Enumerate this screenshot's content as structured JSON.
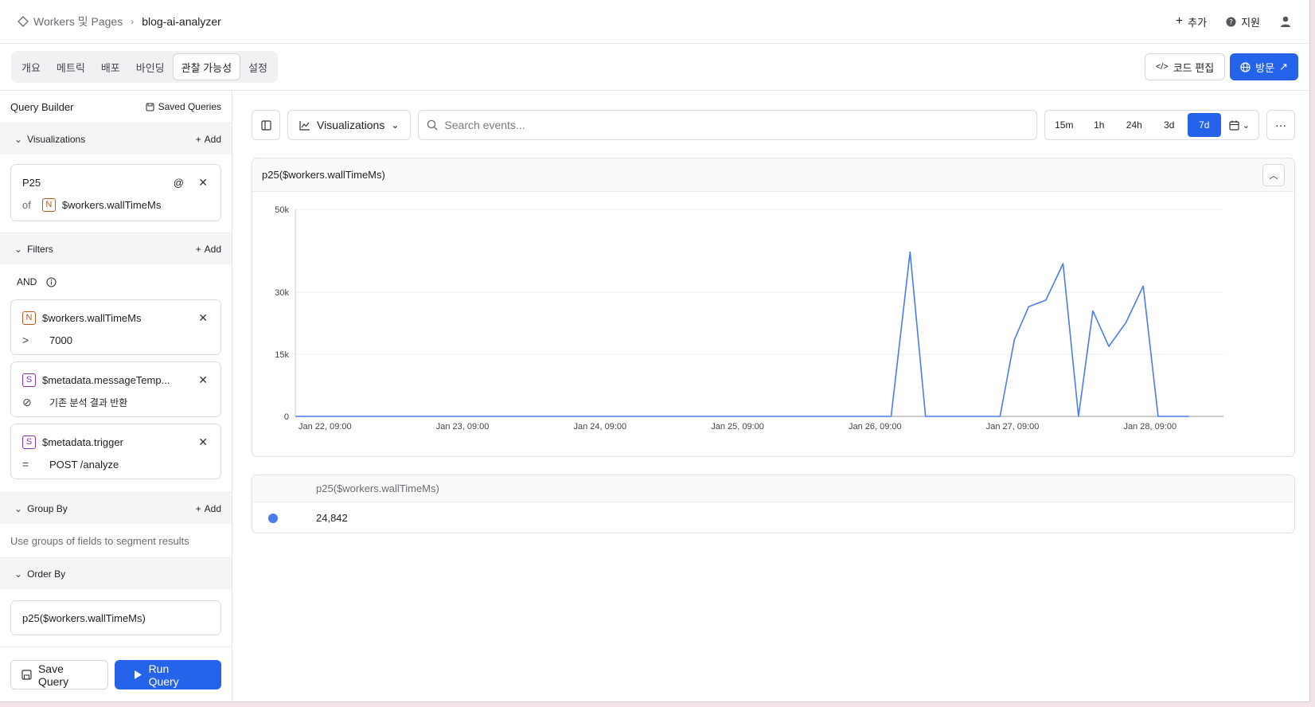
{
  "header": {
    "breadcrumb_parent": "Workers 및 Pages",
    "breadcrumb_current": "blog-ai-analyzer",
    "add_label": "추가",
    "support_label": "지원"
  },
  "tabs": [
    "개요",
    "메트릭",
    "배포",
    "바인딩",
    "관찰 가능성",
    "설정"
  ],
  "active_tab": "관찰 가능성",
  "actions": {
    "edit_code": "코드 편집",
    "visit": "방문"
  },
  "sidebar": {
    "title": "Query Builder",
    "saved_queries": "Saved Queries",
    "visualizations": {
      "label": "Visualizations",
      "add": "Add",
      "item": {
        "func": "P25",
        "of": "of",
        "type_badge": "N",
        "field": "$workers.wallTimeMs"
      }
    },
    "filters": {
      "label": "Filters",
      "add": "Add",
      "logic": "AND",
      "items": [
        {
          "badge": "N",
          "field": "$workers.wallTimeMs",
          "operator": ">",
          "value": "7000"
        },
        {
          "badge": "S",
          "field": "$metadata.messageTemp...",
          "operator": "⊘",
          "value": "기존 분석 결과 반환"
        },
        {
          "badge": "S",
          "field": "$metadata.trigger",
          "operator": "=",
          "value": "POST /analyze"
        }
      ]
    },
    "group_by": {
      "label": "Group By",
      "add": "Add",
      "hint": "Use groups of fields to segment results"
    },
    "order_by": {
      "label": "Order By",
      "item": "p25($workers.wallTimeMs)"
    },
    "save_query": "Save Query",
    "run_query": "Run Query"
  },
  "toolbar": {
    "visualizations_label": "Visualizations",
    "search_placeholder": "Search events...",
    "ranges": [
      "15m",
      "1h",
      "24h",
      "3d",
      "7d"
    ],
    "active_range": "7d"
  },
  "chart_data": {
    "type": "line",
    "title": "p25($workers.wallTimeMs)",
    "ylim": [
      0,
      50000
    ],
    "y_ticks": [
      {
        "value": 0,
        "label": "0"
      },
      {
        "value": 15000,
        "label": "15k"
      },
      {
        "value": 30000,
        "label": "30k"
      },
      {
        "value": 50000,
        "label": "50k"
      }
    ],
    "x_ticks": [
      "Jan 22, 09:00",
      "Jan 23, 09:00",
      "Jan 24, 09:00",
      "Jan 25, 09:00",
      "Jan 26, 09:00",
      "Jan 27, 09:00",
      "Jan 28, 09:00"
    ],
    "x_range_hours": [
      0,
      162
    ],
    "series": [
      {
        "color": "#4b7bec",
        "points": [
          [
            0,
            0
          ],
          [
            104,
            0
          ],
          [
            107.3,
            39700
          ],
          [
            110,
            0
          ],
          [
            123,
            0
          ],
          [
            125.5,
            18500
          ],
          [
            128,
            26500
          ],
          [
            131,
            28100
          ],
          [
            134,
            36900
          ],
          [
            136.7,
            0
          ],
          [
            139.2,
            25500
          ],
          [
            142,
            16900
          ],
          [
            145,
            22700
          ],
          [
            148,
            31500
          ],
          [
            150.6,
            0
          ],
          [
            156,
            0
          ]
        ]
      }
    ],
    "grid": true
  },
  "result_table": {
    "header": "p25($workers.wallTimeMs)",
    "value": "24,842"
  }
}
